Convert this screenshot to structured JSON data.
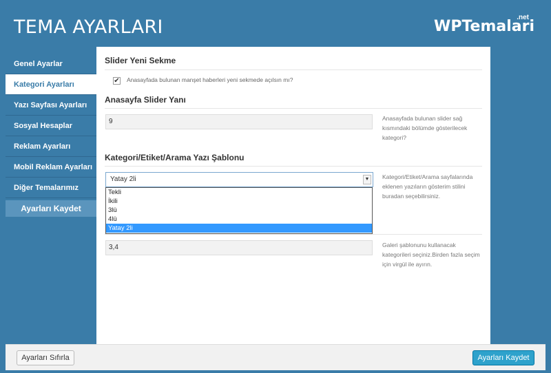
{
  "header": {
    "title": "TEMA AYARLARI",
    "logo": "WPTemalari",
    "logo_suffix": ".net"
  },
  "sidebar": {
    "items": [
      {
        "label": "Genel Ayarlar"
      },
      {
        "label": "Kategori Ayarları"
      },
      {
        "label": "Yazı Sayfası Ayarları"
      },
      {
        "label": "Sosyal Hesaplar"
      },
      {
        "label": "Reklam Ayarları"
      },
      {
        "label": "Mobil Reklam Ayarları"
      },
      {
        "label": "Diğer Temalarımız"
      }
    ],
    "active_index": 1,
    "save_label": "Ayarları Kaydet"
  },
  "main": {
    "slider_new_tab": {
      "title": "Slider Yeni Sekme",
      "checked": true,
      "label": "Anasayfada bulunan manşet haberleri yeni sekmede açılsın mı?"
    },
    "slider_side": {
      "title": "Anasayfa Slider Yanı",
      "value": "9",
      "help": "Anasayfada bulunan slider sağ kısmındaki bölümde gösterilecek kategori?"
    },
    "template": {
      "title": "Kategori/Etiket/Arama Yazı Şablonu",
      "selected": "Yatay 2li",
      "options": [
        "Tekli",
        "İkili",
        "3lü",
        "4lü",
        "Yatay 2li"
      ],
      "help": "Kategori/Etiket/Arama sayfalarında eklenen yazıların gösterim stilini buradan seçebilirsiniz."
    },
    "gallery": {
      "value": "3,4",
      "help": "Galeri şablonunu kullanacak kategorileri seçiniz.Birden fazla seçim için virgül ile ayırın."
    }
  },
  "footer": {
    "reset_label": "Ayarları Sıfırla",
    "save_label": "Ayarları Kaydet"
  },
  "colors": {
    "brand": "#3a7ca8",
    "primary_button": "#2ea2cc",
    "selected_option": "#3399ff"
  }
}
